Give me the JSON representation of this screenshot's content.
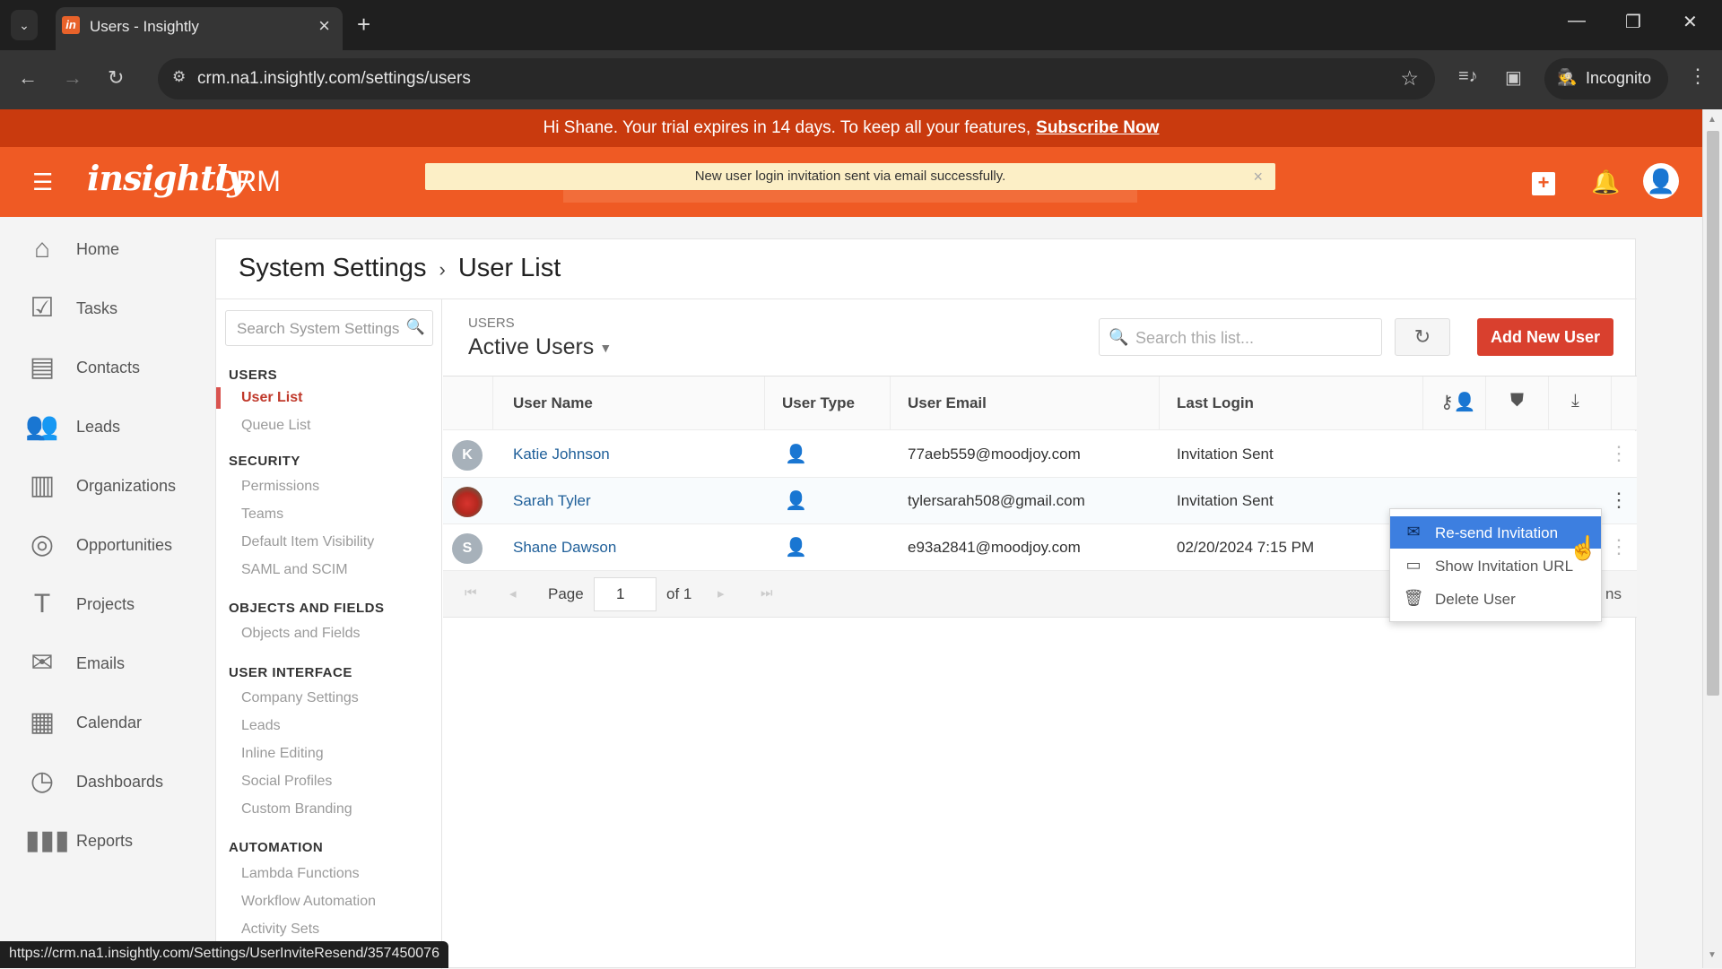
{
  "browser": {
    "tab_title": "Users - Insightly",
    "favicon": "in",
    "url": "crm.na1.insightly.com/settings/users",
    "profile_label": "Incognito",
    "status_url": "https://crm.na1.insightly.com/Settings/UserInviteResend/357450076"
  },
  "banner": {
    "message": "Hi Shane. Your trial expires in 14 days. To keep all your features,",
    "link": "Subscribe Now"
  },
  "header": {
    "logo": "insightly",
    "product": "CRM",
    "toast": "New user login invitation sent via email successfully."
  },
  "nav": {
    "items": [
      {
        "label": "Home",
        "icon": "home-icon"
      },
      {
        "label": "Tasks",
        "icon": "tasks-icon"
      },
      {
        "label": "Contacts",
        "icon": "contacts-icon"
      },
      {
        "label": "Leads",
        "icon": "leads-icon"
      },
      {
        "label": "Organizations",
        "icon": "organizations-icon"
      },
      {
        "label": "Opportunities",
        "icon": "opportunities-icon"
      },
      {
        "label": "Projects",
        "icon": "projects-icon"
      },
      {
        "label": "Emails",
        "icon": "emails-icon"
      },
      {
        "label": "Calendar",
        "icon": "calendar-icon"
      },
      {
        "label": "Dashboards",
        "icon": "dashboards-icon"
      },
      {
        "label": "Reports",
        "icon": "reports-icon"
      }
    ]
  },
  "breadcrumb": {
    "parent": "System Settings",
    "sep": "›",
    "current": "User List"
  },
  "settings": {
    "search_placeholder": "Search System Settings",
    "sections": [
      {
        "title": "USERS",
        "links": [
          "User List",
          "Queue List"
        ]
      },
      {
        "title": "SECURITY",
        "links": [
          "Permissions",
          "Teams",
          "Default Item Visibility",
          "SAML and SCIM"
        ]
      },
      {
        "title": "OBJECTS AND FIELDS",
        "links": [
          "Objects and Fields"
        ]
      },
      {
        "title": "USER INTERFACE",
        "links": [
          "Company Settings",
          "Leads",
          "Inline Editing",
          "Social Profiles",
          "Custom Branding"
        ]
      },
      {
        "title": "AUTOMATION",
        "links": [
          "Lambda Functions",
          "Workflow Automation",
          "Activity Sets"
        ]
      }
    ],
    "active_link": "User List"
  },
  "users": {
    "section_label": "USERS",
    "view": "Active Users",
    "search_placeholder": "Search this list...",
    "add_button": "Add New User",
    "columns": [
      "User Name",
      "User Type",
      "User Email",
      "Last Login"
    ],
    "column_icons": [
      "user-key-icon",
      "shield-icon",
      "download-icon"
    ],
    "rows": [
      {
        "initial": "K",
        "name": "Katie Johnson",
        "email": "77aeb559@moodjoy.com",
        "last_login": "Invitation Sent",
        "avatar": "initial"
      },
      {
        "initial": "",
        "name": "Sarah Tyler",
        "email": "tylersarah508@gmail.com",
        "last_login": "Invitation Sent",
        "avatar": "photo"
      },
      {
        "initial": "S",
        "name": "Shane Dawson",
        "email": "e93a2841@moodjoy.com",
        "last_login": "02/20/2024 7:15 PM",
        "avatar": "initial"
      }
    ],
    "pager": {
      "label": "Page",
      "page": "1",
      "of": "of 1",
      "right_fragment": "ns"
    }
  },
  "context_menu": {
    "items": [
      {
        "label": "Re-send Invitation",
        "icon": "envelope-icon",
        "highlighted": true
      },
      {
        "label": "Show Invitation URL",
        "icon": "link-url-icon",
        "highlighted": false
      },
      {
        "label": "Delete User",
        "icon": "trash-icon",
        "highlighted": false
      }
    ]
  },
  "colors": {
    "brand_orange": "#ef5a24",
    "banner_red": "#c93a0e",
    "add_button": "#d9402e",
    "menu_highlight": "#3d7fe0",
    "link_blue": "#1f5f99",
    "active_link": "#c0392b"
  }
}
